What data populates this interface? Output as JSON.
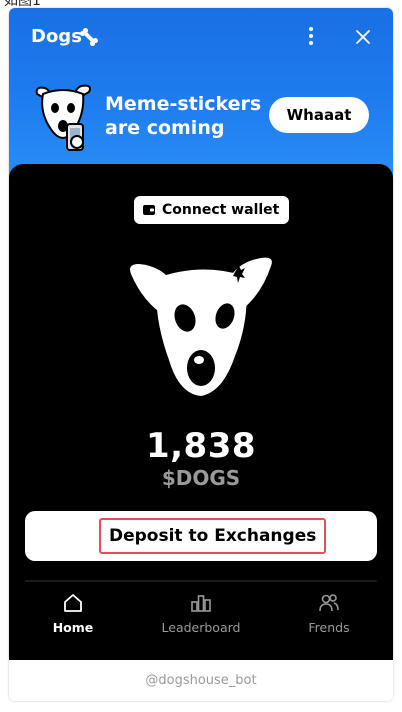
{
  "caption": "如图1",
  "header": {
    "title": "Dogs",
    "title_icon": "bone-icon",
    "menu_icon": "more-vertical-icon",
    "close_icon": "close-icon"
  },
  "promo": {
    "text_line1": "Meme-stickers",
    "text_line2": "are coming",
    "button_label": "Whaaat"
  },
  "wallet": {
    "button_label": "Connect wallet",
    "icon": "wallet-icon"
  },
  "balance": {
    "amount": "1,838",
    "currency": "$DOGS"
  },
  "deposit": {
    "label": "Deposit to Exchanges"
  },
  "tabs": [
    {
      "label": "Home",
      "icon": "home-icon",
      "active": true
    },
    {
      "label": "Leaderboard",
      "icon": "leaderboard-icon",
      "active": false
    },
    {
      "label": "Frends",
      "icon": "friends-icon",
      "active": false
    }
  ],
  "footer": {
    "text": "@dogshouse_bot"
  },
  "colors": {
    "header_blue": "#1e7df0",
    "panel_black": "#000000",
    "highlight_red": "#e84b5c",
    "muted_gray": "#9a9a9a"
  }
}
